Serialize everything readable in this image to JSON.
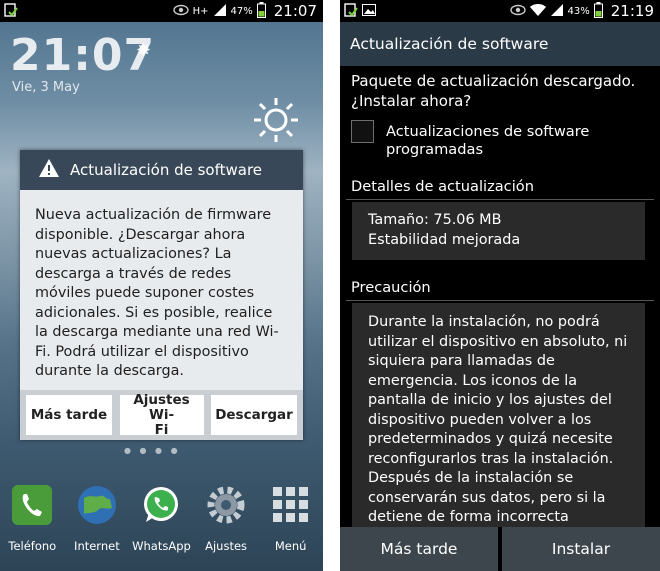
{
  "left_screen": {
    "status_bar": {
      "battery_pct": "47%",
      "time": "21:07",
      "network": "H+",
      "icons": [
        "check-icon",
        "eye-icon",
        "signal-icon",
        "battery-icon"
      ]
    },
    "lockscreen": {
      "clock": "21:07",
      "date": "Vie, 3 May",
      "weather_icon": "sun-icon"
    },
    "dialog": {
      "title": "Actualización de software",
      "icon": "warning-icon",
      "message_lines": [
        "Nueva actualización de firmware",
        "disponible. ¿Descargar ahora",
        "nuevas actualizaciones? La",
        "descarga a través de redes",
        "móviles puede suponer costes",
        "adicionales. Si es posible, realice",
        "la descarga mediante una red Wi-",
        "Fi. Podrá utilizar el dispositivo",
        "durante la descarga."
      ],
      "buttons": {
        "later": "Más tarde",
        "wifi_line1": "Ajustes Wi-",
        "wifi_line2": "Fi",
        "download": "Descargar"
      }
    },
    "dock": [
      {
        "label": "Teléfono",
        "icon": "phone-icon"
      },
      {
        "label": "Internet",
        "icon": "globe-icon"
      },
      {
        "label": "WhatsApp",
        "icon": "whatsapp-icon"
      },
      {
        "label": "Ajustes",
        "icon": "gear-icon"
      },
      {
        "label": "Menú",
        "icon": "grid-icon"
      }
    ]
  },
  "right_screen": {
    "status_bar": {
      "battery_pct": "43%",
      "time": "21:19",
      "icons": [
        "check-icon",
        "image-icon",
        "eye-icon",
        "wifi-icon",
        "signal-icon",
        "battery-icon"
      ]
    },
    "title": "Actualización de software",
    "package_line1": "Paquete de actualización descargado.",
    "package_line2": "¿Instalar ahora?",
    "scheduled_label_line1": "Actualizaciones de software",
    "scheduled_label_line2": "programadas",
    "details_header": "Detalles de actualización",
    "size": "Tamaño: 75.06 MB",
    "stability": "Estabilidad mejorada",
    "caution_header": "Precaución",
    "caution_lines": [
      "Durante la instalación, no podrá",
      "utilizar el dispositivo en absoluto, ni",
      "siquiera para llamadas de",
      "emergencia. Los iconos de la",
      "pantalla de inicio y los ajustes del",
      "dispositivo pueden volver a los",
      "predeterminados y quizá necesite",
      "reconfigurarlos tras la instalación.",
      "Después de la instalación se",
      "conservarán sus datos, pero si la",
      "detiene de forma incorrecta"
    ],
    "buttons": {
      "later": "Más tarde",
      "install": "Instalar"
    }
  },
  "colors": {
    "dialog_header": "#394858",
    "right_header": "#2b3a47",
    "button_bg": "#3d464d"
  }
}
